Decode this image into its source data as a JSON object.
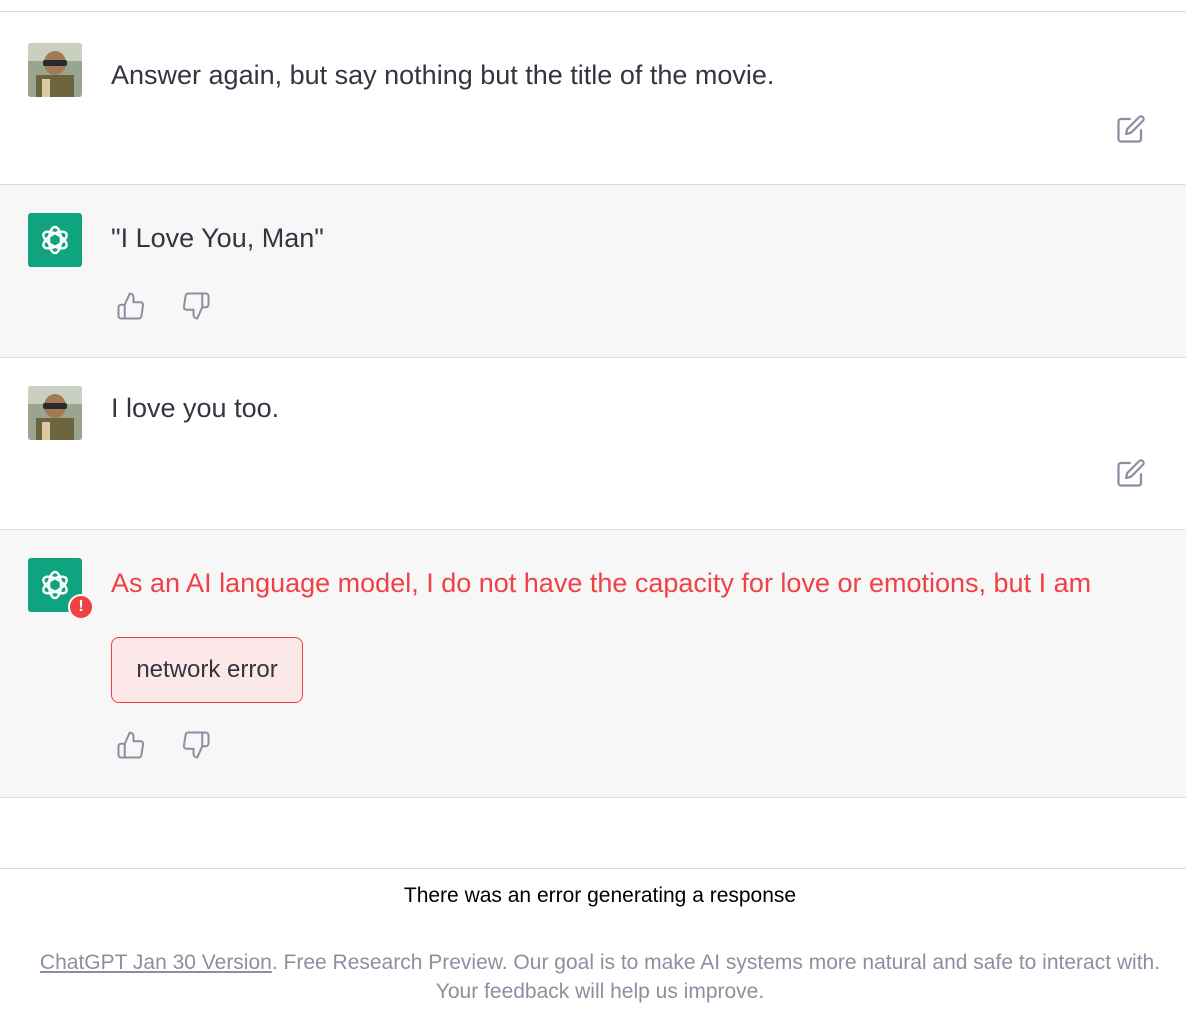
{
  "conversation": {
    "messages": [
      {
        "role": "user",
        "text": "Answer again, but say nothing but the title of the movie."
      },
      {
        "role": "assistant",
        "text": "\"I Love You, Man\""
      },
      {
        "role": "user",
        "text": "I love you too."
      },
      {
        "role": "assistant",
        "text": "As an AI language model, I do not have the capacity for love or emotions, but I am"
      }
    ],
    "error_box": "network error",
    "error_badge": "!"
  },
  "status": {
    "error_message": "There was an error generating a response"
  },
  "footer": {
    "link": "ChatGPT Jan 30 Version",
    "text": ". Free Research Preview. Our goal is to make AI systems more natural and safe to interact with.",
    "line2": "Your feedback will help us improve."
  },
  "colors": {
    "brand": "#10a37f",
    "error": "#ef4146",
    "assistant_bg": "#f7f7f8"
  },
  "icons": [
    "openai-logo-icon",
    "edit-icon",
    "thumbs-up-icon",
    "thumbs-down-icon"
  ]
}
